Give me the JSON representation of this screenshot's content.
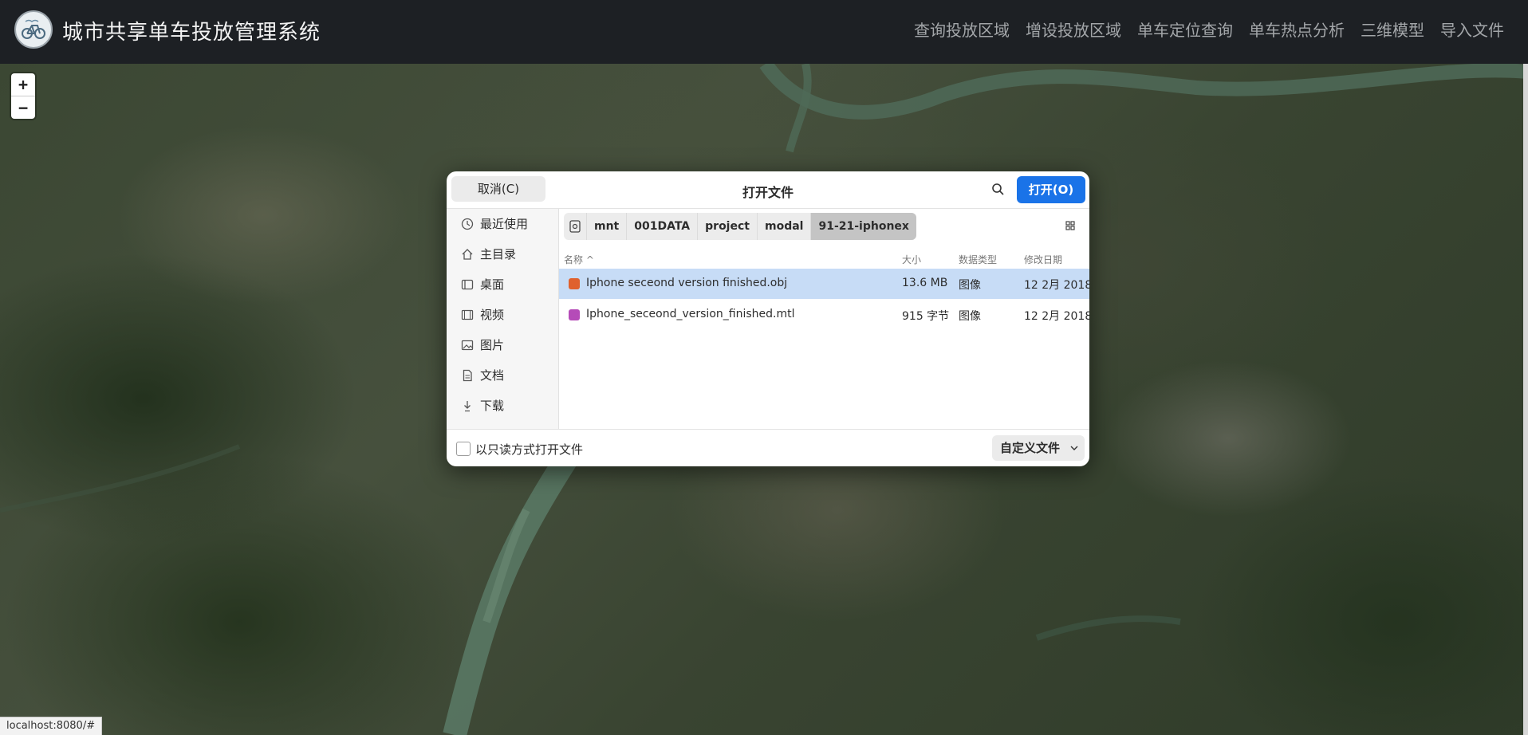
{
  "app": {
    "title": "城市共享单车投放管理系统",
    "nav": [
      "查询投放区域",
      "增设投放区域",
      "单车定位查询",
      "单车热点分析",
      "三维模型",
      "导入文件"
    ]
  },
  "map": {
    "zoom_in": "+",
    "zoom_out": "−"
  },
  "status_url": "localhost:8080/#",
  "dialog": {
    "title": "打开文件",
    "cancel": "取消(C)",
    "open": "打开(O)",
    "sidebar": [
      {
        "label": "最近使用",
        "icon": "clock-icon"
      },
      {
        "label": "主目录",
        "icon": "home-icon"
      },
      {
        "label": "桌面",
        "icon": "desktop-icon"
      },
      {
        "label": "视频",
        "icon": "video-icon"
      },
      {
        "label": "图片",
        "icon": "image-icon"
      },
      {
        "label": "文档",
        "icon": "document-icon"
      },
      {
        "label": "下载",
        "icon": "download-icon"
      }
    ],
    "path": [
      "mnt",
      "001DATA",
      "project",
      "modal",
      "91-21-iphonex"
    ],
    "columns": {
      "name": "名称",
      "size": "大小",
      "type": "数据类型",
      "date": "修改日期"
    },
    "files": [
      {
        "name": "Iphone seceond version finished.obj",
        "size": "13.6 MB",
        "type": "图像",
        "date": "12 2月 2018",
        "selected": true,
        "icon_color": "#e0612d"
      },
      {
        "name": "Iphone_seceond_version_finished.mtl",
        "size": "915 字节",
        "type": "图像",
        "date": "12 2月 2018",
        "selected": false,
        "icon_color": "#b54bb8"
      }
    ],
    "readonly_label": "以只读方式打开文件",
    "filter": "自定义文件"
  },
  "colors": {
    "accent": "#1a73e8",
    "selection": "#c7dcf6",
    "navbar": "#1d2024"
  }
}
